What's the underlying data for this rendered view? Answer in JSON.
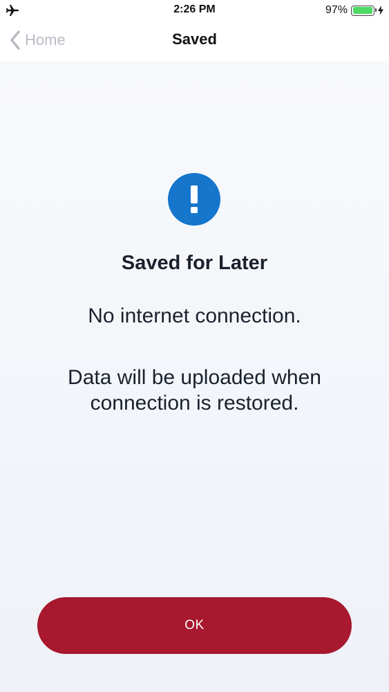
{
  "status_bar": {
    "left_icon": "airplane-mode-icon",
    "time": "2:26 PM",
    "battery_percent": "97%",
    "battery_level": 0.97,
    "battery_color": "#4cd964",
    "charging_icon": "charging-bolt-icon"
  },
  "nav": {
    "back_label": "Home",
    "back_icon": "chevron-left-icon",
    "title": "Saved"
  },
  "main": {
    "icon": "exclamation-circle-icon",
    "icon_color": "#1576cc",
    "headline": "Saved for Later",
    "message_1": "No internet connection.",
    "message_2_line_1": "Data will be uploaded when",
    "message_2_line_2": "connection is restored.",
    "ok_label": "OK",
    "button_color": "#a8182e"
  }
}
